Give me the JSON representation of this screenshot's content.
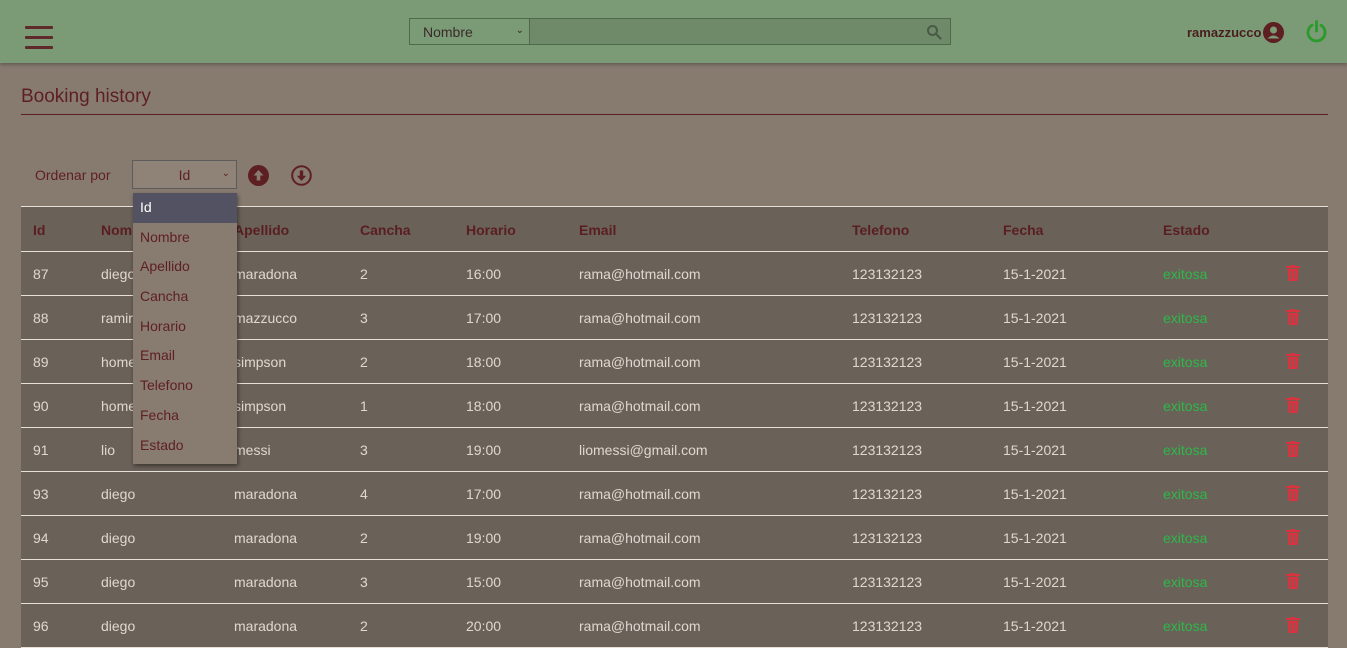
{
  "header": {
    "menu_icon": "hamburger-icon",
    "search": {
      "field_selected": "Nombre",
      "value": "",
      "placeholder": ""
    },
    "username": "ramazzucco",
    "colors": {
      "bar": "#7a9b76",
      "power": "#2a9a2a"
    }
  },
  "page": {
    "title": "Booking history"
  },
  "sort": {
    "label": "Ordenar por",
    "selected": "Id",
    "options": [
      "Id",
      "Nombre",
      "Apellido",
      "Cancha",
      "Horario",
      "Email",
      "Telefono",
      "Fecha",
      "Estado"
    ]
  },
  "table": {
    "columns": [
      "Id",
      "Nombre",
      "Apellido",
      "Cancha",
      "Horario",
      "Email",
      "Telefono",
      "Fecha",
      "Estado"
    ],
    "rows": [
      {
        "id": "87",
        "nombre": "diego",
        "apellido": "maradona",
        "cancha": "2",
        "horario": "16:00",
        "email": "rama@hotmail.com",
        "telefono": "123132123",
        "fecha": "15-1-2021",
        "estado": "exitosa"
      },
      {
        "id": "88",
        "nombre": "ramiro",
        "apellido": "mazzucco",
        "cancha": "3",
        "horario": "17:00",
        "email": "rama@hotmail.com",
        "telefono": "123132123",
        "fecha": "15-1-2021",
        "estado": "exitosa"
      },
      {
        "id": "89",
        "nombre": "homero",
        "apellido": "simpson",
        "cancha": "2",
        "horario": "18:00",
        "email": "rama@hotmail.com",
        "telefono": "123132123",
        "fecha": "15-1-2021",
        "estado": "exitosa"
      },
      {
        "id": "90",
        "nombre": "homero",
        "apellido": "simpson",
        "cancha": "1",
        "horario": "18:00",
        "email": "rama@hotmail.com",
        "telefono": "123132123",
        "fecha": "15-1-2021",
        "estado": "exitosa"
      },
      {
        "id": "91",
        "nombre": "lio",
        "apellido": "messi",
        "cancha": "3",
        "horario": "19:00",
        "email": "liomessi@gmail.com",
        "telefono": "123132123",
        "fecha": "15-1-2021",
        "estado": "exitosa"
      },
      {
        "id": "93",
        "nombre": "diego",
        "apellido": "maradona",
        "cancha": "4",
        "horario": "17:00",
        "email": "rama@hotmail.com",
        "telefono": "123132123",
        "fecha": "15-1-2021",
        "estado": "exitosa"
      },
      {
        "id": "94",
        "nombre": "diego",
        "apellido": "maradona",
        "cancha": "2",
        "horario": "19:00",
        "email": "rama@hotmail.com",
        "telefono": "123132123",
        "fecha": "15-1-2021",
        "estado": "exitosa"
      },
      {
        "id": "95",
        "nombre": "diego",
        "apellido": "maradona",
        "cancha": "3",
        "horario": "15:00",
        "email": "rama@hotmail.com",
        "telefono": "123132123",
        "fecha": "15-1-2021",
        "estado": "exitosa"
      },
      {
        "id": "96",
        "nombre": "diego",
        "apellido": "maradona",
        "cancha": "2",
        "horario": "20:00",
        "email": "rama@hotmail.com",
        "telefono": "123132123",
        "fecha": "15-1-2021",
        "estado": "exitosa"
      }
    ],
    "row_action_icon": "trash-icon",
    "status_color": "#2db84a",
    "delete_color": "#d9333f"
  }
}
